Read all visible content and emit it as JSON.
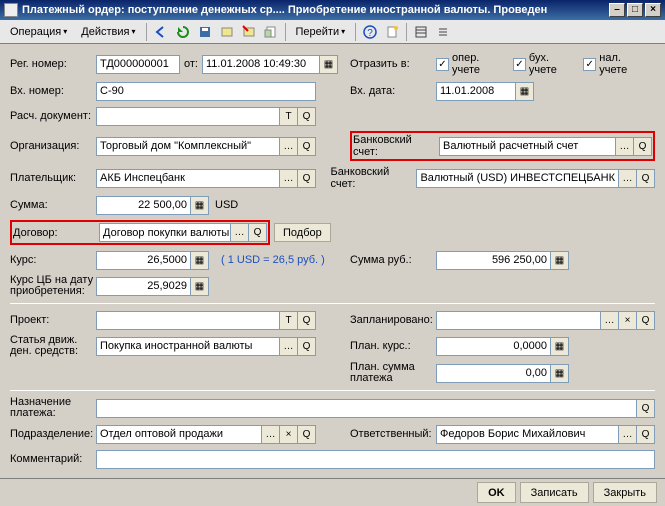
{
  "window": {
    "title": "Платежный ордер: поступление денежных ср.... Приобретение иностранной валюты. Проведен"
  },
  "menu": {
    "operation": "Операция",
    "actions": "Действия",
    "goto": "Перейти"
  },
  "labels": {
    "reg_no": "Рег. номер:",
    "from": "от:",
    "reflect_in": "Отразить в:",
    "in_no": "Вх. номер:",
    "in_date": "Вх. дата:",
    "calc_doc": "Расч. документ:",
    "org": "Организация:",
    "bank_acc": "Банковский счет:",
    "payer": "Плательщик:",
    "amount": "Сумма:",
    "cur": "USD",
    "contract": "Договор:",
    "select": "Подбор",
    "rate": "Курс:",
    "rate_hint": "( 1 USD = 26,5 руб. )",
    "amount_rub": "Сумма руб.:",
    "cb_rate": "Курс ЦБ на дату приобретения:",
    "project": "Проект:",
    "planned": "Запланировано:",
    "cash_item": "Статья движ. ден. средств:",
    "plan_rate": "План. курс.:",
    "plan_amount": "План. сумма платежа",
    "purpose": "Назначение платежа:",
    "dept": "Подразделение:",
    "responsible": "Ответственный:",
    "comment": "Комментарий:"
  },
  "checks": {
    "oper": "опер. учете",
    "buh": "бух. учете",
    "nal": "нал. учете"
  },
  "values": {
    "reg_no": "ТД000000001",
    "reg_date": "11.01.2008 10:49:30",
    "in_no": "С-90",
    "in_date": "11.01.2008",
    "calc_doc": "",
    "org": "Торговый дом \"Комплексный\"",
    "bank_acc1": "Валютный расчетный счет",
    "payer": "АКБ Инспецбанк",
    "bank_acc2": "Валютный (USD) ИНВЕСТСПЕЦБАНК",
    "amount": "22 500,00",
    "contract": "Договор покупки валюты",
    "rate": "26,5000",
    "amount_rub": "596 250,00",
    "cb_rate": "25,9029",
    "project": "",
    "planned": "",
    "cash_item": "Покупка иностранной валюты",
    "plan_rate": "0,0000",
    "plan_amount": "0,00",
    "purpose": "",
    "dept": "Отдел оптовой продажи",
    "responsible": "Федоров Борис Михайлович",
    "comment": ""
  },
  "footer": {
    "ok": "OK",
    "save": "Записать",
    "close": "Закрыть"
  }
}
